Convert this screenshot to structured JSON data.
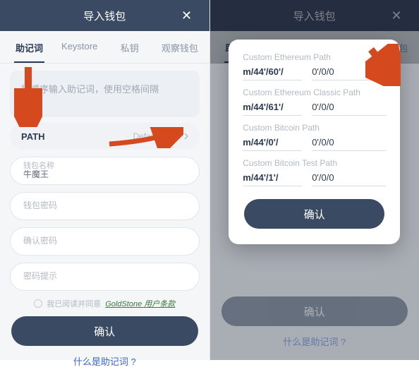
{
  "header": {
    "title": "导入钱包",
    "close": "✕"
  },
  "tabs": [
    "助记词",
    "Keystore",
    "私钥",
    "观察钱包"
  ],
  "mnemonic_placeholder": "按顺序输入助记词，使用空格间隔",
  "path": {
    "label": "PATH",
    "value": "Default Path"
  },
  "fields": {
    "name_label": "钱包名称",
    "name_value": "牛魔王",
    "pwd_label": "钱包密码",
    "confirm_label": "确认密码",
    "hint_label": "密码提示"
  },
  "agree": {
    "prefix": "我已阅读并同意",
    "link": "GoldStone 用户条款"
  },
  "confirm": "确认",
  "help_link": "什么是助记词",
  "modal": {
    "groups": [
      {
        "label": "Custom Ethereum Path",
        "prefix": "m/44'/60'/",
        "suffix": "0'/0/0"
      },
      {
        "label": "Custom Ethereum Classic Path",
        "prefix": "m/44'/61'/",
        "suffix": "0'/0/0"
      },
      {
        "label": "Custom Bitcoin Path",
        "prefix": "m/44'/0'/",
        "suffix": "0'/0/0"
      },
      {
        "label": "Custom Bitcoin Test Path",
        "prefix": "m/44'/1'/",
        "suffix": "0'/0/0"
      }
    ],
    "confirm": "确认"
  }
}
